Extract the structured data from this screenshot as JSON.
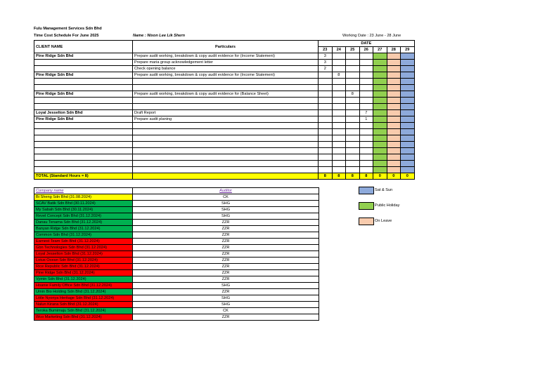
{
  "header": {
    "company": "Fulu Management Services Sdn Bhd",
    "schedule": "Time Cost Schedule For June 2025",
    "name": "Name : Nixon Lee Lik Shern",
    "working_date": "Working Date :  23 June - 28 June"
  },
  "table": {
    "col_client": "CLIENT NAME",
    "col_particulars": "Particulars",
    "col_date": "DATE",
    "days": [
      "23",
      "24",
      "25",
      "26",
      "27",
      "28",
      "29"
    ],
    "day_colors": [
      "",
      "",
      "",
      "",
      "#92d050",
      "#f8cbad",
      "#8eaadb"
    ],
    "rows": [
      {
        "client": "Pine Ridge Sdn Bhd",
        "particulars": "Prepare audit working, breakdown & copy audit evidence for  (Income Statement)",
        "hours": [
          "3",
          "",
          "",
          "",
          "",
          "",
          ""
        ]
      },
      {
        "client": "",
        "particulars": "Prepare maria group acknowledgement letter",
        "hours": [
          "3",
          "",
          "",
          "",
          "",
          "",
          ""
        ]
      },
      {
        "client": "",
        "particulars": "Check opening balance",
        "hours": [
          "2",
          "",
          "",
          "",
          "",
          "",
          ""
        ]
      },
      {
        "client": "Pine Ridge Sdn Bhd",
        "particulars": "Prepare audit working, breakdown & copy audit evidence for  (Income Statement)",
        "hours": [
          "",
          "8",
          "",
          "",
          "",
          "",
          ""
        ]
      },
      {
        "client": "",
        "particulars": "",
        "hours": [
          "",
          "",
          "",
          "",
          "",
          "",
          ""
        ]
      },
      {
        "client": "",
        "particulars": "",
        "hours": [
          "",
          "",
          "",
          "",
          "",
          "",
          ""
        ]
      },
      {
        "client": "Pine Ridge Sdn Bhd",
        "particulars": "Prepare audit working, breakdown & copy audit evidence for  (Balance Sheet)",
        "hours": [
          "",
          "",
          "8",
          "",
          "",
          "",
          ""
        ]
      },
      {
        "client": "",
        "particulars": "",
        "hours": [
          "",
          "",
          "",
          "",
          "",
          "",
          ""
        ]
      },
      {
        "client": "",
        "particulars": "",
        "hours": [
          "",
          "",
          "",
          "",
          "",
          "",
          ""
        ]
      },
      {
        "client": "Loyal Jesselton Sdn Bhd",
        "particulars": "Draft Report",
        "hours": [
          "",
          "",
          "",
          "7",
          "",
          "",
          ""
        ]
      },
      {
        "client": "Pine Ridge Sdn Bhd",
        "particulars": "Prepare audit planing",
        "hours": [
          "",
          "",
          "",
          "1",
          "",
          "",
          ""
        ]
      },
      {
        "client": "",
        "particulars": "",
        "hours": [
          "",
          "",
          "",
          "",
          "",
          "",
          ""
        ]
      },
      {
        "client": "",
        "particulars": "",
        "hours": [
          "",
          "",
          "",
          "",
          "",
          "",
          ""
        ]
      },
      {
        "client": "",
        "particulars": "",
        "hours": [
          "",
          "",
          "",
          "",
          "",
          "",
          ""
        ]
      },
      {
        "client": "",
        "particulars": "",
        "hours": [
          "",
          "",
          "",
          "",
          "",
          "",
          ""
        ]
      },
      {
        "client": "",
        "particulars": "",
        "hours": [
          "",
          "",
          "",
          "",
          "",
          "",
          ""
        ]
      },
      {
        "client": "",
        "particulars": "",
        "hours": [
          "",
          "",
          "",
          "",
          "",
          "",
          ""
        ]
      },
      {
        "client": "",
        "particulars": "",
        "hours": [
          "",
          "",
          "",
          "",
          "",
          "",
          ""
        ]
      },
      {
        "client": "",
        "particulars": "",
        "hours": [
          "",
          "",
          "",
          "",
          "",
          "",
          ""
        ]
      }
    ],
    "total_label": "TOTAL (Standard Hours = 8)",
    "totals": [
      "8",
      "8",
      "8",
      "8",
      "0",
      "0",
      "0"
    ]
  },
  "companies": {
    "col_company": "Company name",
    "col_auditor": "Auditor",
    "status_colors": {
      "yellow": "#ffff00",
      "green": "#00b050",
      "red": "#ff0000"
    },
    "rows": [
      {
        "name": "Bi Sheng Sdn Bhd (31.08.2024)",
        "auditor": "CK",
        "status": "yellow"
      },
      {
        "name": "SCAV Batik Sdn Bhd (30.11.2024)",
        "auditor": "SHG",
        "status": "green"
      },
      {
        "name": "My Sabah Sdn Bhd (30.11.2024)",
        "auditor": "SHG",
        "status": "green"
      },
      {
        "name": "Revel Concept Sdn Bhd (31.12.2024)",
        "auditor": "SHG",
        "status": "green"
      },
      {
        "name": "Danau Tenama Sdn Bhd (31.12.2024)",
        "auditor": "ZZR",
        "status": "green"
      },
      {
        "name": "Banyan Ridge Sdn Bhd (31.12.2024)",
        "auditor": "ZZR",
        "status": "green"
      },
      {
        "name": "Common Sdn Bhd (31.12.2024)",
        "auditor": "ZZR",
        "status": "green"
      },
      {
        "name": "Earnest Team Sdn Bhd (31.12.2024)",
        "auditor": "ZZR",
        "status": "red"
      },
      {
        "name": "Gbn Technologies Sdn Bhd (31.12.2024)",
        "auditor": "ZZR",
        "status": "red"
      },
      {
        "name": "Loyal Jesselton Sdn Bhd (31.12.2024)",
        "auditor": "ZZR",
        "status": "red"
      },
      {
        "name": "Lotus Ocean Sdn Bhd (31.12.2024)",
        "auditor": "ZZR",
        "status": "red"
      },
      {
        "name": "Rice Republic Sdn Bhd (31.12.2024)",
        "auditor": "ZZR",
        "status": "red"
      },
      {
        "name": "Pine Ridge Sdn Bhd (31.12.2024)",
        "auditor": "ZZR",
        "status": "red"
      },
      {
        "name": "Vymin Sdn Bhd (31.12.2024)",
        "auditor": "ZZR",
        "status": "green"
      },
      {
        "name": "Hoanie Family Office Sdn Bhd (31.12.2024)",
        "auditor": "SHG",
        "status": "red"
      },
      {
        "name": "Umin Bio Holding Sdn Bhd (31.12.2024)",
        "auditor": "ZZR",
        "status": "green"
      },
      {
        "name": "Little Nyonya Heritage Sdn Bhd (31.12.2024)",
        "auditor": "SHG",
        "status": "red"
      },
      {
        "name": "Nalun Kirana Sdn Bhd (31.12.2024)",
        "auditor": "SHG",
        "status": "red"
      },
      {
        "name": "Teroka Bumimaju Sdn Bhd (31.12.2024)",
        "auditor": "CK",
        "status": "green"
      },
      {
        "name": "Wco Marketing Sdn Bhd (31.12.2024)",
        "auditor": "ZZR",
        "status": "red"
      }
    ]
  },
  "legend": [
    {
      "label": "Sat & Sun",
      "color": "#8eaadb"
    },
    {
      "label": "Public Holiday",
      "color": "#92d050"
    },
    {
      "label": "On Leave",
      "color": "#f8cbad"
    }
  ]
}
